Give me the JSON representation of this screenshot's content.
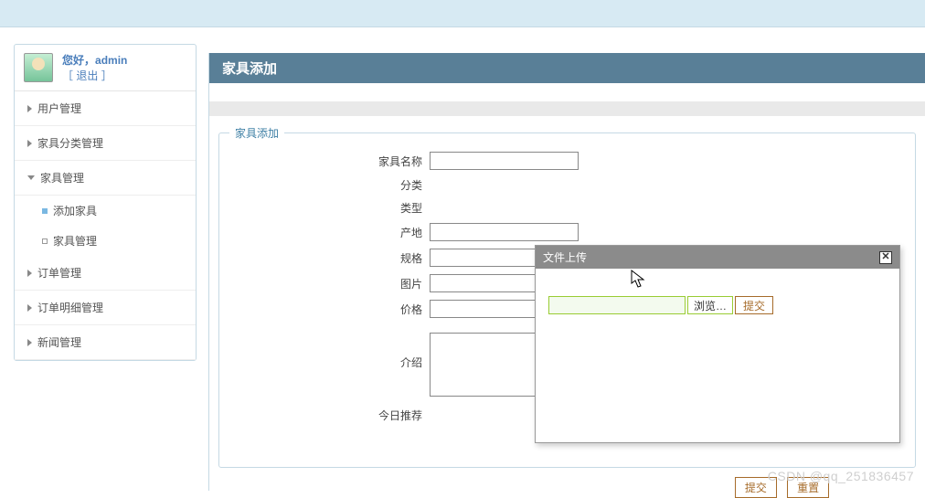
{
  "user": {
    "greeting": "您好，",
    "name": "admin",
    "logout_left": "［ ",
    "logout": "退出",
    "logout_right": " ］"
  },
  "sidebar": {
    "items": [
      {
        "label": "用户管理"
      },
      {
        "label": "家具分类管理"
      },
      {
        "label": "家具管理"
      },
      {
        "label": "订单管理"
      },
      {
        "label": "订单明细管理"
      },
      {
        "label": "新闻管理"
      }
    ],
    "sub": [
      {
        "label": "添加家具"
      },
      {
        "label": "家具管理"
      }
    ]
  },
  "page": {
    "title": "家具添加",
    "section_title": "家具添加"
  },
  "form": {
    "labels": {
      "name": "家具名称",
      "category": "分类",
      "type": "类型",
      "origin": "产地",
      "spec": "规格",
      "image": "图片",
      "price": "价格",
      "intro": "介绍",
      "recommend": "今日推荐"
    },
    "values": {
      "name": "",
      "origin": "",
      "spec": "",
      "image": "",
      "price": ""
    },
    "buttons": {
      "submit": "提交",
      "reset": "重置"
    }
  },
  "dialog": {
    "title": "文件上传",
    "browse": "浏览…",
    "submit": "提交"
  },
  "watermark": "CSDN @qq_251836457"
}
